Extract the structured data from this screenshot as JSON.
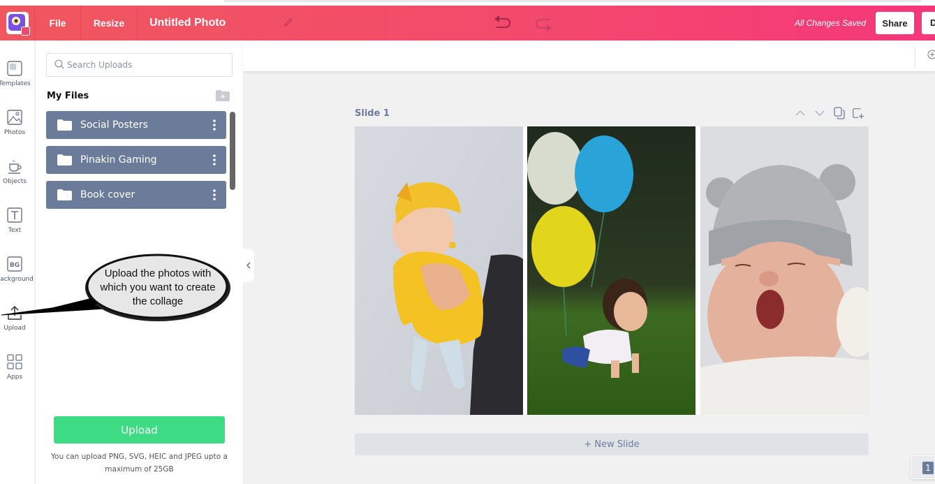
{
  "header": {
    "menu_file": "File",
    "menu_resize": "Resize",
    "doc_title": "Untitled Photo",
    "save_status": "All Changes Saved",
    "share_label": "Share",
    "download_label_partial": "D",
    "colors": {
      "gradient_start": "#f0575e",
      "gradient_end": "#f5377a"
    }
  },
  "leftnav": {
    "items": [
      {
        "label": "Templates",
        "icon": "templates-icon"
      },
      {
        "label": "Photos",
        "icon": "photos-icon"
      },
      {
        "label": "Objects",
        "icon": "objects-icon"
      },
      {
        "label": "Text",
        "icon": "text-icon"
      },
      {
        "label": "Background",
        "icon": "background-icon"
      },
      {
        "label": "Upload",
        "icon": "upload-icon"
      },
      {
        "label": "Apps",
        "icon": "apps-icon"
      }
    ]
  },
  "uploads_panel": {
    "search_placeholder": "Search Uploads",
    "section_title": "My Files",
    "folders": [
      {
        "name": "Social Posters"
      },
      {
        "name": "Pinakin Gaming"
      },
      {
        "name": "Book cover"
      }
    ],
    "upload_button": "Upload",
    "upload_hint": "You can upload PNG, SVG, HEIC and JPEG upto a maximum of 25GB",
    "accent_color": "#3ddc84",
    "folder_color": "#6b7c9b"
  },
  "annotation": {
    "callout_text": "Upload the photos with which you want to create the collage"
  },
  "canvas": {
    "slide_label": "Slide 1",
    "photos": [
      {
        "description": "Baby in yellow hat and sweater held up by hands"
      },
      {
        "description": "Toddler crawling on grass with balloons"
      },
      {
        "description": "Newborn yawning in grey knit hat"
      }
    ],
    "new_slide_label": "+ New Slide",
    "page_number": "1"
  }
}
